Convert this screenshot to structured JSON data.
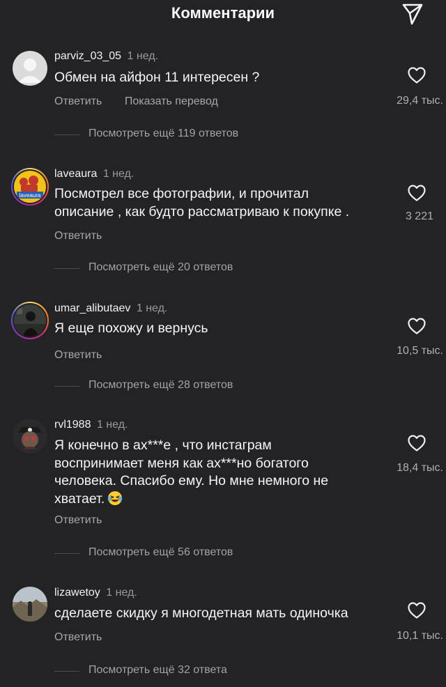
{
  "header": {
    "title": "Комментарии",
    "send_icon": "paper-plane-icon"
  },
  "comments": [
    {
      "username": "parviz_03_05",
      "time": "1 нед.",
      "text": "Обмен на айфон 11 интересен ?",
      "reply_label": "Ответить",
      "translate_label": "Показать перевод",
      "likes": "29,4 тыс.",
      "view_replies": "Посмотреть ещё 119 ответов"
    },
    {
      "username": "laveaura",
      "time": "1 нед.",
      "text_lines": [
        "Посмотрел все фотографии, и прочитал",
        "описание , как будто рассматриваю к покупке ."
      ],
      "avatar_text": "laveaura",
      "reply_label": "Ответить",
      "likes": "3 221",
      "view_replies": "Посмотреть ещё 20 ответов"
    },
    {
      "username": "umar_alibutaev",
      "time": "1 нед.",
      "text": "Я еще похожу и вернусь",
      "reply_label": "Ответить",
      "likes": "10,5 тыс.",
      "view_replies": "Посмотреть ещё 28 ответов"
    },
    {
      "username": "rvl1988",
      "time": "1 нед.",
      "text_lines": [
        "Я конечно в ах***е , что инстаграм",
        "воспринимает меня как ах***но богатого",
        "человека. Спасибо ему. Но мне немного не",
        "хватает."
      ],
      "emoji": "laughing-tears-emoji",
      "reply_label": "Ответить",
      "likes": "18,4 тыс.",
      "view_replies": "Посмотреть ещё 56 ответов"
    },
    {
      "username": "lizawetoy",
      "time": "1 нед.",
      "text": "сделаете скидку я многодетная мать одиночка",
      "reply_label": "Ответить",
      "likes": "10,1 тыс.",
      "view_replies": "Посмотреть ещё 32 ответа"
    }
  ],
  "colors": {
    "background": "#232326",
    "text": "#f5f5f5",
    "muted": "#a8a8ac"
  },
  "icons": {
    "like": "heart-outline-icon",
    "send": "paper-plane-icon"
  }
}
